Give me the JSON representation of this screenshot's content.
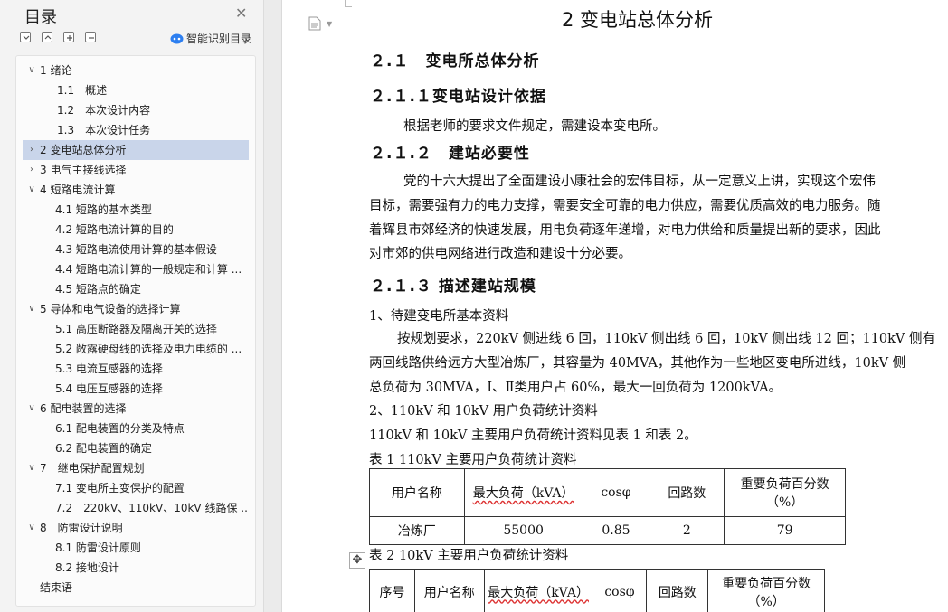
{
  "sidebar": {
    "title": "目录",
    "smart_toc_label": "智能识别目录",
    "items": [
      {
        "label": "1 绪论",
        "level": 1,
        "expanded": true
      },
      {
        "label": "1.1　概述",
        "level": 2
      },
      {
        "label": "1.2　本次设计内容",
        "level": 2
      },
      {
        "label": "1.3　本次设计任务",
        "level": 2
      },
      {
        "label": "2 变电站总体分析",
        "level": 1,
        "expanded": false,
        "selected": true
      },
      {
        "label": "3 电气主接线选择",
        "level": 1,
        "expanded": false
      },
      {
        "label": "4 短路电流计算",
        "level": 1,
        "expanded": true
      },
      {
        "label": "4.1 短路的基本类型",
        "level": 2
      },
      {
        "label": "4.2 短路电流计算的目的",
        "level": 2
      },
      {
        "label": "4.3 短路电流使用计算的基本假设",
        "level": 2
      },
      {
        "label": "4.4 短路电流计算的一般规定和计算 ...",
        "level": 2
      },
      {
        "label": "4.5  短路点的确定",
        "level": 2
      },
      {
        "label": "5 导体和电气设备的选择计算",
        "level": 1,
        "expanded": true
      },
      {
        "label": "5.1 高压断路器及隔离开关的选择",
        "level": 2
      },
      {
        "label": "5.2  敞露硬母线的选择及电力电缆的 ...",
        "level": 2
      },
      {
        "label": "5.3  电流互感器的选择",
        "level": 2
      },
      {
        "label": "5.4 电压互感器的选择",
        "level": 2
      },
      {
        "label": "6 配电装置的选择",
        "level": 1,
        "expanded": true
      },
      {
        "label": "6.1  配电装置的分类及特点",
        "level": 2
      },
      {
        "label": "6.2  配电装置的确定",
        "level": 2
      },
      {
        "label": "7　继电保护配置规划",
        "level": 1,
        "expanded": true
      },
      {
        "label": "7.1  变电所主变保护的配置",
        "level": 2
      },
      {
        "label": "7.2　220kV、110kV、10kV 线路保 ...",
        "level": 2
      },
      {
        "label": "8　防雷设计说明",
        "level": 1,
        "expanded": true
      },
      {
        "label": "8.1  防雷设计原则",
        "level": 2
      },
      {
        "label": "8.2  接地设计",
        "level": 2
      },
      {
        "label": "结束语",
        "level": 0
      }
    ]
  },
  "document": {
    "chapter_title": "2 变电站总体分析",
    "sec_2_1": "２.１　变电所总体分析",
    "sec_2_1_1": "２.１.１变电站设计依据",
    "p_2_1_1": "根据老师的要求文件规定，需建设本变电所。",
    "sec_2_1_2": "２.１.２　建站必要性",
    "p_2_1_2_lines": [
      "党的十六大提出了全面建设小康社会的宏伟目标，从一定意义上讲，实现这个宏伟",
      "目标，需要强有力的电力支撑，需要安全可靠的电力供应，需要优质高效的电力服务。随",
      "着辉县市郊经济的快速发展，用电负荷逐年递增，对电力供给和质量提出新的要求，因此",
      "对市郊的供电网络进行改造和建设十分必要。"
    ],
    "sec_2_1_3": "２.１.３ 描述建站规模",
    "item_1": "1、待建变电所基本资料",
    "p_2_1_3_lines": [
      "按规划要求，220kV 侧进线 6 回，110kV 侧出线 6 回，10kV 侧出线 12 回；110kV 侧有",
      "两回线路供给远方大型冶炼厂，其容量为 40MVA，其他作为一些地区变电所进线，10kV 侧",
      "总负荷为 30MVA，Ⅰ、Ⅱ类用户占 60%，最大一回负荷为 1200kVA。"
    ],
    "item_2": "2、110kV 和 10kV 用户负荷统计资料",
    "p_tables_intro": "110kV 和 10kV 主要用户负荷统计资料见表 1 和表 2。",
    "table1_caption": "表 1 110kV 主要用户负荷统计资料",
    "table1": {
      "headers": [
        "用户名称",
        "最大负荷（kVA）",
        "cosφ",
        "回路数",
        "重要负荷百分数（%）"
      ],
      "rows": [
        [
          "冶炼厂",
          "55000",
          "0.85",
          "2",
          "79"
        ]
      ]
    },
    "table2_caption": "表 2 10kV 主要用户负荷统计资料",
    "table2": {
      "headers": [
        "序号",
        "用户名称",
        "最大负荷（kVA）",
        "cosφ",
        "回路数",
        "重要负荷百分数（%）"
      ]
    }
  }
}
